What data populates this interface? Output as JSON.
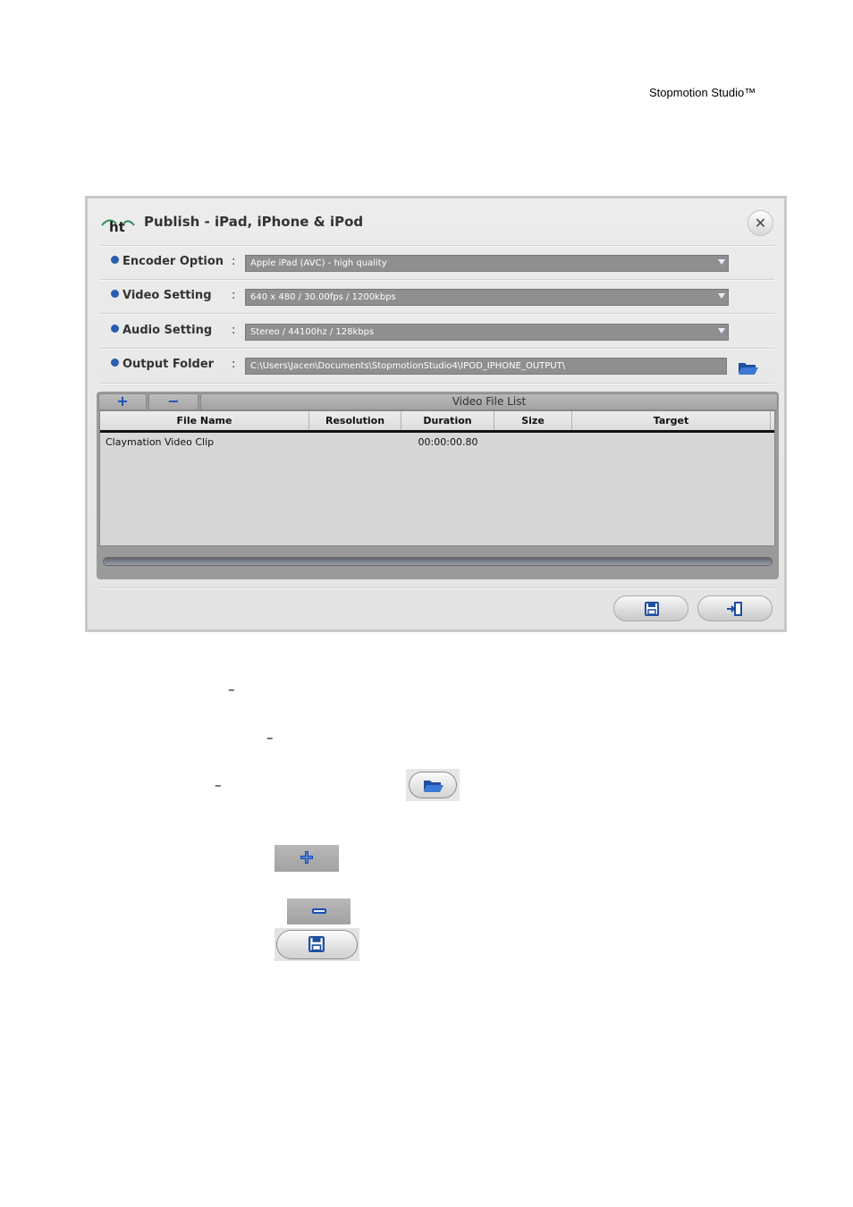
{
  "header": {
    "product": "Stopmotion Studio™"
  },
  "dialog": {
    "title": "Publish - iPad, iPhone & iPod",
    "logo_text": "ht",
    "close_glyph": "✕",
    "rows": [
      {
        "label": "Encoder Option",
        "colon": ":",
        "value": "Apple iPad (AVC) - high quality"
      },
      {
        "label": "Video Setting",
        "colon": ":",
        "value": "640 x 480 / 30.00fps / 1200kbps"
      },
      {
        "label": "Audio Setting",
        "colon": ":",
        "value": "Stereo / 44100hz / 128kbps"
      },
      {
        "label": "Output Folder",
        "colon": ":",
        "value": "C:\\Users\\Jacen\\Documents\\StopmotionStudio4\\IPOD_IPHONE_OUTPUT\\"
      }
    ],
    "file_list": {
      "title": "Video File List",
      "add_glyph": "+",
      "remove_glyph": "−",
      "columns": [
        "File Name",
        "Resolution",
        "Duration",
        "Size",
        "Target"
      ],
      "rows": [
        {
          "file_name": "Claymation Video Clip",
          "resolution": "",
          "duration": "00:00:00.80",
          "size": "",
          "target": ""
        }
      ],
      "progress": 0
    },
    "buttons": {
      "save_icon": "save-icon",
      "exit_icon": "exit-icon"
    }
  },
  "instructions": {
    "dash": "–"
  },
  "colors": {
    "accent": "#2a5db0",
    "field_bg": "#8f8f8f",
    "list_bg": "#9a9a9a"
  }
}
